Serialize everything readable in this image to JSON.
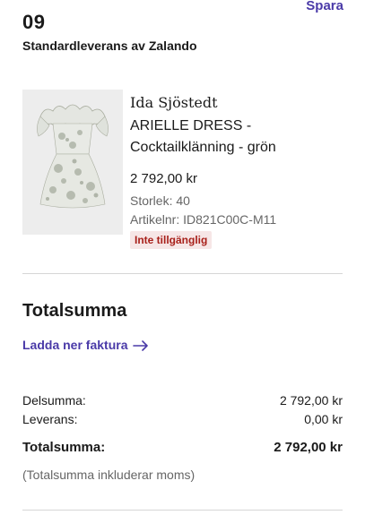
{
  "header": {
    "save_label": "Spara",
    "order_number": "09",
    "delivery_type": "Standardleverans av Zalando"
  },
  "product": {
    "image_icon": "dress-image",
    "brand": "Ida Sjöstedt",
    "name": "ARIELLE DRESS - Cocktailklänning - grön",
    "price": "2 792,00 kr",
    "size": "Storlek: 40",
    "article": "Artikelnr: ID821C00C-M11",
    "status": "Inte tillgänglig",
    "status_color": "#a8201a"
  },
  "summary": {
    "heading": "Totalsumma",
    "invoice_link": "Ladda ner faktura",
    "rows": [
      {
        "label": "Delsumma:",
        "value": "2 792,00 kr"
      },
      {
        "label": "Leverans:",
        "value": "0,00 kr"
      }
    ],
    "total_label": "Totalsumma:",
    "total_value": "2 792,00 kr",
    "vat_note": "(Totalsumma inkluderar moms)"
  },
  "colors": {
    "accent": "#4a3aa8",
    "divider": "#d6d6d6"
  }
}
